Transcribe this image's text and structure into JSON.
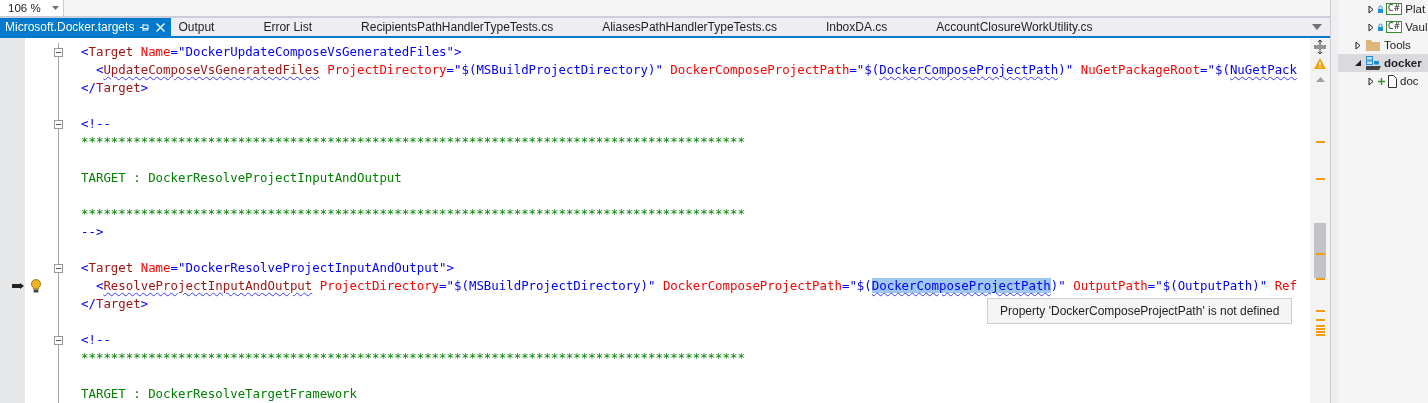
{
  "zoom_box": {
    "value": "106 %"
  },
  "tabs": [
    {
      "label": "Microsoft.Docker.targets",
      "selected": true
    },
    {
      "label": "Output",
      "selected": false
    },
    {
      "label": "Error List",
      "selected": false
    },
    {
      "label": "RecipientsPathHandlerTypeTests.cs",
      "selected": false
    },
    {
      "label": "AliasesPathHandlerTypeTests.cs",
      "selected": false
    },
    {
      "label": "InboxDA.cs",
      "selected": false
    },
    {
      "label": "AccountClosureWorkUtility.cs",
      "selected": false
    }
  ],
  "editor": {
    "lines": [
      {
        "kind": "code",
        "fold": true,
        "segments": [
          {
            "kind": "delim",
            "text": "<"
          },
          {
            "kind": "element",
            "text": "Target"
          },
          {
            "kind": "attr",
            "text": " Name"
          },
          {
            "kind": "value",
            "text": "=\"DockerUpdateComposeVsGeneratedFiles\""
          },
          {
            "kind": "delim",
            "text": ">"
          }
        ]
      },
      {
        "kind": "code",
        "segments": [
          {
            "kind": "delim",
            "text": "  <"
          },
          {
            "kind": "element",
            "text": "UpdateComposeVsGeneratedFiles",
            "squiggle": true
          },
          {
            "kind": "attr",
            "text": " ProjectDirectory"
          },
          {
            "kind": "value",
            "text": "=\"$(MSBuildProjectDirectory)\""
          },
          {
            "kind": "attr",
            "text": " DockerComposeProjectPath"
          },
          {
            "kind": "value",
            "text": "=\"$("
          },
          {
            "kind": "value",
            "text": "DockerComposeProjectPath",
            "squiggle": true
          },
          {
            "kind": "value",
            "text": ")\""
          },
          {
            "kind": "attr",
            "text": " NuGetPackageRoot"
          },
          {
            "kind": "value",
            "text": "=\"$("
          },
          {
            "kind": "value",
            "text": "NuGetPack",
            "squiggle": true
          }
        ]
      },
      {
        "kind": "code",
        "segments": [
          {
            "kind": "delim",
            "text": "</"
          },
          {
            "kind": "element",
            "text": "Target"
          },
          {
            "kind": "delim",
            "text": ">"
          }
        ]
      },
      {
        "kind": "blank"
      },
      {
        "kind": "code",
        "fold": true,
        "segments": [
          {
            "kind": "delim",
            "text": "<!--"
          }
        ]
      },
      {
        "kind": "code",
        "segments": [
          {
            "kind": "comment",
            "text": "*****************************************************************************************"
          }
        ]
      },
      {
        "kind": "blank"
      },
      {
        "kind": "code",
        "segments": [
          {
            "kind": "comment",
            "text": "TARGET : DockerResolveProjectInputAndOutput"
          }
        ]
      },
      {
        "kind": "blank"
      },
      {
        "kind": "code",
        "segments": [
          {
            "kind": "comment",
            "text": "*****************************************************************************************"
          }
        ]
      },
      {
        "kind": "code",
        "segments": [
          {
            "kind": "delim",
            "text": "-->"
          }
        ]
      },
      {
        "kind": "blank"
      },
      {
        "kind": "code",
        "fold": true,
        "segments": [
          {
            "kind": "delim",
            "text": "<"
          },
          {
            "kind": "element",
            "text": "Target"
          },
          {
            "kind": "attr",
            "text": " Name"
          },
          {
            "kind": "value",
            "text": "=\"DockerResolveProjectInputAndOutput\""
          },
          {
            "kind": "delim",
            "text": ">"
          }
        ]
      },
      {
        "kind": "code",
        "current_line": true,
        "lightbulb": true,
        "segments": [
          {
            "kind": "delim",
            "text": "  <"
          },
          {
            "kind": "element",
            "text": "ResolveProjectInputAndOutput",
            "squiggle": true
          },
          {
            "kind": "attr",
            "text": " ProjectDirectory"
          },
          {
            "kind": "value",
            "text": "=\"$(MSBuildProjectDirectory)\""
          },
          {
            "kind": "attr",
            "text": " DockerComposeProjectPath"
          },
          {
            "kind": "value",
            "text": "=\"$("
          },
          {
            "kind": "value",
            "text": "DockerComposeProjectPath",
            "squiggle": true,
            "selected": true
          },
          {
            "kind": "value",
            "text": ")\""
          },
          {
            "kind": "attr",
            "text": " OutputPath"
          },
          {
            "kind": "value",
            "text": "=\"$(OutputPath)\""
          },
          {
            "kind": "attr",
            "text": " Ref"
          }
        ]
      },
      {
        "kind": "code",
        "segments": [
          {
            "kind": "delim",
            "text": "</"
          },
          {
            "kind": "element",
            "text": "Target"
          },
          {
            "kind": "delim",
            "text": ">"
          }
        ]
      },
      {
        "kind": "blank"
      },
      {
        "kind": "code",
        "fold": true,
        "segments": [
          {
            "kind": "delim",
            "text": "<!--"
          }
        ]
      },
      {
        "kind": "code",
        "segments": [
          {
            "kind": "comment",
            "text": "*****************************************************************************************"
          }
        ]
      },
      {
        "kind": "blank"
      },
      {
        "kind": "code",
        "segments": [
          {
            "kind": "comment",
            "text": "TARGET : DockerResolveTargetFramework"
          }
        ]
      }
    ],
    "tooltip": "Property 'DockerComposeProjectPath' is not defined"
  },
  "solution_tree": [
    {
      "kind": "hidden_parent",
      "children": [
        {
          "kind": "csharp_project",
          "badge": "C#",
          "label": "Plat",
          "expanded": false,
          "selected": false
        },
        {
          "kind": "csharp_project",
          "badge": "C#",
          "label": "Vaul",
          "expanded": false,
          "selected": false
        }
      ]
    },
    {
      "kind": "folder",
      "label": "Tools",
      "expanded": false,
      "selected": false
    },
    {
      "kind": "container_project",
      "label": "docker",
      "expanded": true,
      "selected": true,
      "children": [
        {
          "kind": "new_file",
          "label": "doc",
          "expanded": false,
          "selected": false
        }
      ]
    }
  ]
}
